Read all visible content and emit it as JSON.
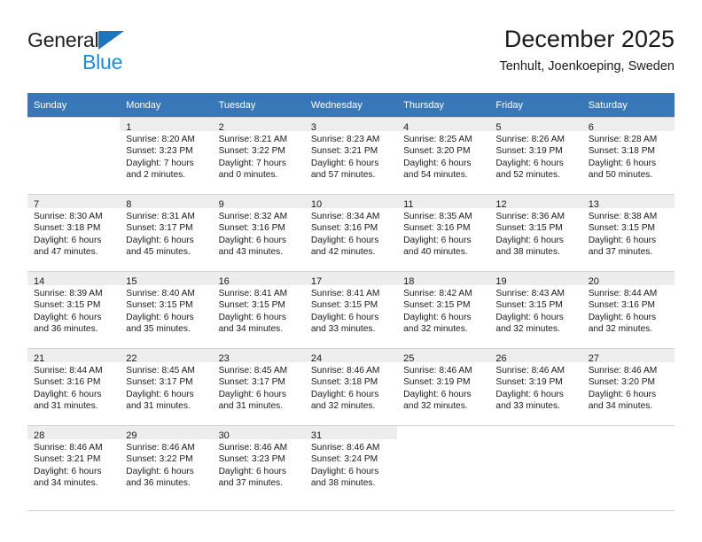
{
  "brand": {
    "name_part1": "General",
    "name_part2": "Blue",
    "accent_color": "#1b8ed6",
    "triangle_color": "#1b76bc"
  },
  "header": {
    "title": "December 2025",
    "subtitle": "Tenhult, Joenkoeping, Sweden"
  },
  "calendar": {
    "header_bg": "#3878b8",
    "weekday_headers": [
      "Sunday",
      "Monday",
      "Tuesday",
      "Wednesday",
      "Thursday",
      "Friday",
      "Saturday"
    ],
    "weeks": [
      [
        {
          "day": "",
          "lines": []
        },
        {
          "day": "1",
          "lines": [
            "Sunrise: 8:20 AM",
            "Sunset: 3:23 PM",
            "Daylight: 7 hours",
            "and 2 minutes."
          ]
        },
        {
          "day": "2",
          "lines": [
            "Sunrise: 8:21 AM",
            "Sunset: 3:22 PM",
            "Daylight: 7 hours",
            "and 0 minutes."
          ]
        },
        {
          "day": "3",
          "lines": [
            "Sunrise: 8:23 AM",
            "Sunset: 3:21 PM",
            "Daylight: 6 hours",
            "and 57 minutes."
          ]
        },
        {
          "day": "4",
          "lines": [
            "Sunrise: 8:25 AM",
            "Sunset: 3:20 PM",
            "Daylight: 6 hours",
            "and 54 minutes."
          ]
        },
        {
          "day": "5",
          "lines": [
            "Sunrise: 8:26 AM",
            "Sunset: 3:19 PM",
            "Daylight: 6 hours",
            "and 52 minutes."
          ]
        },
        {
          "day": "6",
          "lines": [
            "Sunrise: 8:28 AM",
            "Sunset: 3:18 PM",
            "Daylight: 6 hours",
            "and 50 minutes."
          ]
        }
      ],
      [
        {
          "day": "7",
          "lines": [
            "Sunrise: 8:30 AM",
            "Sunset: 3:18 PM",
            "Daylight: 6 hours",
            "and 47 minutes."
          ]
        },
        {
          "day": "8",
          "lines": [
            "Sunrise: 8:31 AM",
            "Sunset: 3:17 PM",
            "Daylight: 6 hours",
            "and 45 minutes."
          ]
        },
        {
          "day": "9",
          "lines": [
            "Sunrise: 8:32 AM",
            "Sunset: 3:16 PM",
            "Daylight: 6 hours",
            "and 43 minutes."
          ]
        },
        {
          "day": "10",
          "lines": [
            "Sunrise: 8:34 AM",
            "Sunset: 3:16 PM",
            "Daylight: 6 hours",
            "and 42 minutes."
          ]
        },
        {
          "day": "11",
          "lines": [
            "Sunrise: 8:35 AM",
            "Sunset: 3:16 PM",
            "Daylight: 6 hours",
            "and 40 minutes."
          ]
        },
        {
          "day": "12",
          "lines": [
            "Sunrise: 8:36 AM",
            "Sunset: 3:15 PM",
            "Daylight: 6 hours",
            "and 38 minutes."
          ]
        },
        {
          "day": "13",
          "lines": [
            "Sunrise: 8:38 AM",
            "Sunset: 3:15 PM",
            "Daylight: 6 hours",
            "and 37 minutes."
          ]
        }
      ],
      [
        {
          "day": "14",
          "lines": [
            "Sunrise: 8:39 AM",
            "Sunset: 3:15 PM",
            "Daylight: 6 hours",
            "and 36 minutes."
          ]
        },
        {
          "day": "15",
          "lines": [
            "Sunrise: 8:40 AM",
            "Sunset: 3:15 PM",
            "Daylight: 6 hours",
            "and 35 minutes."
          ]
        },
        {
          "day": "16",
          "lines": [
            "Sunrise: 8:41 AM",
            "Sunset: 3:15 PM",
            "Daylight: 6 hours",
            "and 34 minutes."
          ]
        },
        {
          "day": "17",
          "lines": [
            "Sunrise: 8:41 AM",
            "Sunset: 3:15 PM",
            "Daylight: 6 hours",
            "and 33 minutes."
          ]
        },
        {
          "day": "18",
          "lines": [
            "Sunrise: 8:42 AM",
            "Sunset: 3:15 PM",
            "Daylight: 6 hours",
            "and 32 minutes."
          ]
        },
        {
          "day": "19",
          "lines": [
            "Sunrise: 8:43 AM",
            "Sunset: 3:15 PM",
            "Daylight: 6 hours",
            "and 32 minutes."
          ]
        },
        {
          "day": "20",
          "lines": [
            "Sunrise: 8:44 AM",
            "Sunset: 3:16 PM",
            "Daylight: 6 hours",
            "and 32 minutes."
          ]
        }
      ],
      [
        {
          "day": "21",
          "lines": [
            "Sunrise: 8:44 AM",
            "Sunset: 3:16 PM",
            "Daylight: 6 hours",
            "and 31 minutes."
          ]
        },
        {
          "day": "22",
          "lines": [
            "Sunrise: 8:45 AM",
            "Sunset: 3:17 PM",
            "Daylight: 6 hours",
            "and 31 minutes."
          ]
        },
        {
          "day": "23",
          "lines": [
            "Sunrise: 8:45 AM",
            "Sunset: 3:17 PM",
            "Daylight: 6 hours",
            "and 31 minutes."
          ]
        },
        {
          "day": "24",
          "lines": [
            "Sunrise: 8:46 AM",
            "Sunset: 3:18 PM",
            "Daylight: 6 hours",
            "and 32 minutes."
          ]
        },
        {
          "day": "25",
          "lines": [
            "Sunrise: 8:46 AM",
            "Sunset: 3:19 PM",
            "Daylight: 6 hours",
            "and 32 minutes."
          ]
        },
        {
          "day": "26",
          "lines": [
            "Sunrise: 8:46 AM",
            "Sunset: 3:19 PM",
            "Daylight: 6 hours",
            "and 33 minutes."
          ]
        },
        {
          "day": "27",
          "lines": [
            "Sunrise: 8:46 AM",
            "Sunset: 3:20 PM",
            "Daylight: 6 hours",
            "and 34 minutes."
          ]
        }
      ],
      [
        {
          "day": "28",
          "lines": [
            "Sunrise: 8:46 AM",
            "Sunset: 3:21 PM",
            "Daylight: 6 hours",
            "and 34 minutes."
          ]
        },
        {
          "day": "29",
          "lines": [
            "Sunrise: 8:46 AM",
            "Sunset: 3:22 PM",
            "Daylight: 6 hours",
            "and 36 minutes."
          ]
        },
        {
          "day": "30",
          "lines": [
            "Sunrise: 8:46 AM",
            "Sunset: 3:23 PM",
            "Daylight: 6 hours",
            "and 37 minutes."
          ]
        },
        {
          "day": "31",
          "lines": [
            "Sunrise: 8:46 AM",
            "Sunset: 3:24 PM",
            "Daylight: 6 hours",
            "and 38 minutes."
          ]
        },
        {
          "day": "",
          "lines": []
        },
        {
          "day": "",
          "lines": []
        },
        {
          "day": "",
          "lines": []
        }
      ]
    ]
  }
}
